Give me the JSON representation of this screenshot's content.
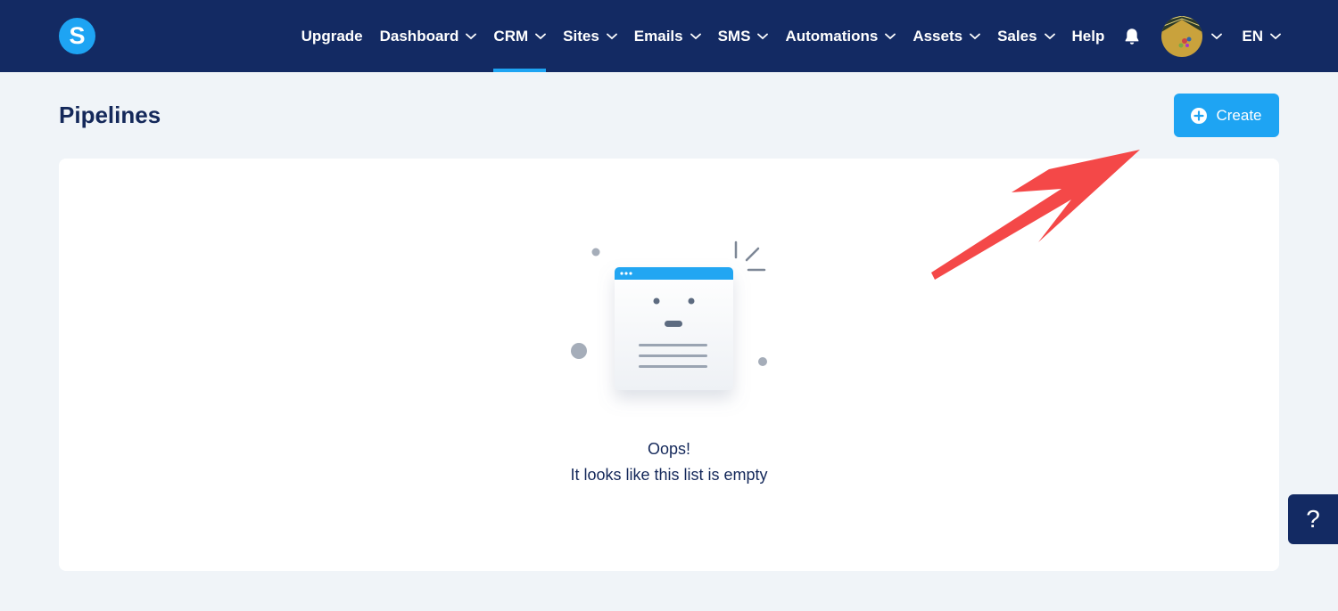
{
  "header": {
    "logo_letter": "S",
    "nav": [
      {
        "label": "Upgrade",
        "has_menu": false
      },
      {
        "label": "Dashboard",
        "has_menu": true
      },
      {
        "label": "CRM",
        "has_menu": true,
        "active": true
      },
      {
        "label": "Sites",
        "has_menu": true
      },
      {
        "label": "Emails",
        "has_menu": true
      },
      {
        "label": "SMS",
        "has_menu": true
      },
      {
        "label": "Automations",
        "has_menu": true
      },
      {
        "label": "Assets",
        "has_menu": true
      },
      {
        "label": "Sales",
        "has_menu": true
      },
      {
        "label": "Help",
        "has_menu": false
      }
    ],
    "language": "EN",
    "icons": {
      "notifications": "bell-icon",
      "avatar": "user-avatar"
    }
  },
  "page": {
    "title": "Pipelines",
    "create_label": "Create"
  },
  "empty_state": {
    "title": "Oops!",
    "subtitle": "It looks like this list is empty"
  },
  "help_widget": {
    "label": "?"
  },
  "colors": {
    "header_bg": "#132a63",
    "accent": "#1ea4f3",
    "page_bg": "#f0f4f8",
    "annotation_arrow": "#f44848"
  }
}
